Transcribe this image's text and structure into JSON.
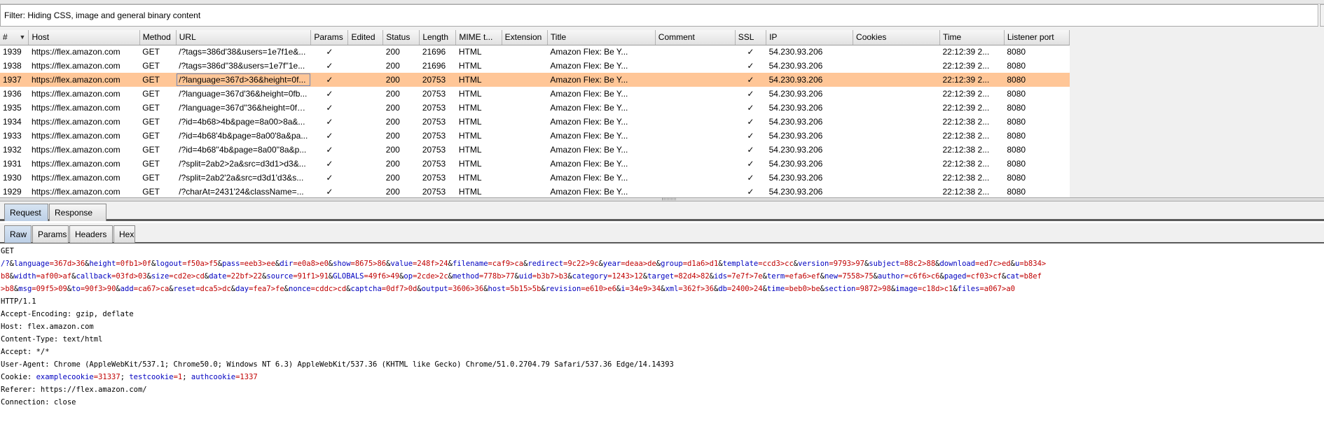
{
  "filter": {
    "text": "Filter: Hiding CSS, image and general binary content"
  },
  "table": {
    "columns": [
      "#",
      "Host",
      "Method",
      "URL",
      "Params",
      "Edited",
      "Status",
      "Length",
      "MIME t...",
      "Extension",
      "Title",
      "Comment",
      "SSL",
      "IP",
      "Cookies",
      "Time",
      "Listener port"
    ],
    "rows": [
      {
        "num": "1939",
        "host": "https://flex.amazon.com",
        "method": "GET",
        "url": "/?tags=386d'38&users=1e7f1e&...",
        "params": "✓",
        "edited": "",
        "status": "200",
        "length": "21696",
        "mime": "HTML",
        "ext": "",
        "title": "Amazon Flex: Be Y...",
        "comment": "",
        "ssl": "✓",
        "ip": "54.230.93.206",
        "cookies": "",
        "time": "22:12:39 2...",
        "port": "8080"
      },
      {
        "num": "1938",
        "host": "https://flex.amazon.com",
        "method": "GET",
        "url": "/?tags=386d''38&users=1e7f''1e...",
        "params": "✓",
        "edited": "",
        "status": "200",
        "length": "21696",
        "mime": "HTML",
        "ext": "",
        "title": "Amazon Flex: Be Y...",
        "comment": "",
        "ssl": "✓",
        "ip": "54.230.93.206",
        "cookies": "",
        "time": "22:12:39 2...",
        "port": "8080"
      },
      {
        "num": "1937",
        "host": "https://flex.amazon.com",
        "method": "GET",
        "url": "/?language=367d>36&height=0f...",
        "params": "✓",
        "edited": "",
        "status": "200",
        "length": "20753",
        "mime": "HTML",
        "ext": "",
        "title": "Amazon Flex: Be Y...",
        "comment": "",
        "ssl": "✓",
        "ip": "54.230.93.206",
        "cookies": "",
        "time": "22:12:39 2...",
        "port": "8080"
      },
      {
        "num": "1936",
        "host": "https://flex.amazon.com",
        "method": "GET",
        "url": "/?language=367d'36&height=0fb...",
        "params": "✓",
        "edited": "",
        "status": "200",
        "length": "20753",
        "mime": "HTML",
        "ext": "",
        "title": "Amazon Flex: Be Y...",
        "comment": "",
        "ssl": "✓",
        "ip": "54.230.93.206",
        "cookies": "",
        "time": "22:12:39 2...",
        "port": "8080"
      },
      {
        "num": "1935",
        "host": "https://flex.amazon.com",
        "method": "GET",
        "url": "/?language=367d''36&height=0fb...",
        "params": "✓",
        "edited": "",
        "status": "200",
        "length": "20753",
        "mime": "HTML",
        "ext": "",
        "title": "Amazon Flex: Be Y...",
        "comment": "",
        "ssl": "✓",
        "ip": "54.230.93.206",
        "cookies": "",
        "time": "22:12:39 2...",
        "port": "8080"
      },
      {
        "num": "1934",
        "host": "https://flex.amazon.com",
        "method": "GET",
        "url": "/?id=4b68>4b&page=8a00>8a&...",
        "params": "✓",
        "edited": "",
        "status": "200",
        "length": "20753",
        "mime": "HTML",
        "ext": "",
        "title": "Amazon Flex: Be Y...",
        "comment": "",
        "ssl": "✓",
        "ip": "54.230.93.206",
        "cookies": "",
        "time": "22:12:38 2...",
        "port": "8080"
      },
      {
        "num": "1933",
        "host": "https://flex.amazon.com",
        "method": "GET",
        "url": "/?id=4b68'4b&page=8a00'8a&pa...",
        "params": "✓",
        "edited": "",
        "status": "200",
        "length": "20753",
        "mime": "HTML",
        "ext": "",
        "title": "Amazon Flex: Be Y...",
        "comment": "",
        "ssl": "✓",
        "ip": "54.230.93.206",
        "cookies": "",
        "time": "22:12:38 2...",
        "port": "8080"
      },
      {
        "num": "1932",
        "host": "https://flex.amazon.com",
        "method": "GET",
        "url": "/?id=4b68''4b&page=8a00''8a&p...",
        "params": "✓",
        "edited": "",
        "status": "200",
        "length": "20753",
        "mime": "HTML",
        "ext": "",
        "title": "Amazon Flex: Be Y...",
        "comment": "",
        "ssl": "✓",
        "ip": "54.230.93.206",
        "cookies": "",
        "time": "22:12:38 2...",
        "port": "8080"
      },
      {
        "num": "1931",
        "host": "https://flex.amazon.com",
        "method": "GET",
        "url": "/?split=2ab2>2a&src=d3d1>d3&...",
        "params": "✓",
        "edited": "",
        "status": "200",
        "length": "20753",
        "mime": "HTML",
        "ext": "",
        "title": "Amazon Flex: Be Y...",
        "comment": "",
        "ssl": "✓",
        "ip": "54.230.93.206",
        "cookies": "",
        "time": "22:12:38 2...",
        "port": "8080"
      },
      {
        "num": "1930",
        "host": "https://flex.amazon.com",
        "method": "GET",
        "url": "/?split=2ab2'2a&src=d3d1'd3&s...",
        "params": "✓",
        "edited": "",
        "status": "200",
        "length": "20753",
        "mime": "HTML",
        "ext": "",
        "title": "Amazon Flex: Be Y...",
        "comment": "",
        "ssl": "✓",
        "ip": "54.230.93.206",
        "cookies": "",
        "time": "22:12:38 2...",
        "port": "8080"
      },
      {
        "num": "1929",
        "host": "https://flex.amazon.com",
        "method": "GET",
        "url": "/?charAt=2431'24&className=...",
        "params": "✓",
        "edited": "",
        "status": "200",
        "length": "20753",
        "mime": "HTML",
        "ext": "",
        "title": "Amazon Flex: Be Y...",
        "comment": "",
        "ssl": "✓",
        "ip": "54.230.93.206",
        "cookies": "",
        "time": "22:12:38 2...",
        "port": "8080"
      }
    ],
    "selected_num": "1937"
  },
  "tabs_top": [
    {
      "label": "Request",
      "active": true
    },
    {
      "label": "Response",
      "active": false
    }
  ],
  "tabs_sub": [
    {
      "label": "Raw",
      "active": true
    },
    {
      "label": "Params",
      "active": false
    },
    {
      "label": "Headers",
      "active": false
    },
    {
      "label": "Hex",
      "active": false
    }
  ],
  "request": {
    "method": "GET",
    "query_lines": [
      [
        [
          "/?",
          ""
        ],
        [
          "language",
          "=367d>36"
        ],
        [
          "height",
          "=0fb1>0f"
        ],
        [
          "logout",
          "=f50a>f5"
        ],
        [
          "pass",
          "=eeb3>ee"
        ],
        [
          "dir",
          "=e0a8>e0"
        ],
        [
          "show",
          "=8675>86"
        ],
        [
          "value",
          "=248f>24"
        ],
        [
          "filename",
          "=caf9>ca"
        ],
        [
          "redirect",
          "=9c22>9c"
        ],
        [
          "year",
          "=deaa>de"
        ],
        [
          "group",
          "=d1a6>d1"
        ],
        [
          "template",
          "=ccd3>cc"
        ],
        [
          "version",
          "=9793>97"
        ],
        [
          "subject",
          "=88c2>88"
        ],
        [
          "download",
          "=ed7c>ed"
        ],
        [
          "u",
          "=b834>"
        ]
      ],
      [
        [
          "",
          "b8"
        ],
        [
          "width",
          "=af00>af"
        ],
        [
          "callback",
          "=03fd>03"
        ],
        [
          "size",
          "=cd2e>cd"
        ],
        [
          "date",
          "=22bf>22"
        ],
        [
          "source",
          "=91f1>91"
        ],
        [
          "GLOBALS",
          "=49f6>49"
        ],
        [
          "op",
          "=2cde>2c"
        ],
        [
          "method",
          "=778b>77"
        ],
        [
          "uid",
          "=b3b7>b3"
        ],
        [
          "category",
          "=1243>12"
        ],
        [
          "target",
          "=82d4>82"
        ],
        [
          "ids",
          "=7e7f>7e"
        ],
        [
          "term",
          "=efa6>ef"
        ],
        [
          "new",
          "=7558>75"
        ],
        [
          "author",
          "=c6f6>c6"
        ],
        [
          "paged",
          "=cf03>cf"
        ],
        [
          "cat",
          "=b8ef"
        ]
      ],
      [
        [
          "",
          ">b8"
        ],
        [
          "msg",
          "=09f5>09"
        ],
        [
          "to",
          "=90f3>90"
        ],
        [
          "add",
          "=ca67>ca"
        ],
        [
          "reset",
          "=dca5>dc"
        ],
        [
          "day",
          "=fea7>fe"
        ],
        [
          "nonce",
          "=cddc>cd"
        ],
        [
          "captcha",
          "=0df7>0d"
        ],
        [
          "output",
          "=3606>36"
        ],
        [
          "host",
          "=5b15>5b"
        ],
        [
          "revision",
          "=e610>e6"
        ],
        [
          "i",
          "=34e9>34"
        ],
        [
          "xml",
          "=362f>36"
        ],
        [
          "db",
          "=2400>24"
        ],
        [
          "time",
          "=beb0>be"
        ],
        [
          "section",
          "=9872>98"
        ],
        [
          "image",
          "=c18d>c1"
        ],
        [
          "files",
          "=a067>a0"
        ]
      ]
    ],
    "http_version": "HTTP/1.1",
    "headers": [
      "Accept-Encoding: gzip, deflate",
      "Host: flex.amazon.com",
      "Content-Type: text/html",
      "Accept: */*",
      "User-Agent: Chrome (AppleWebKit/537.1; Chrome50.0; Windows NT 6.3) AppleWebKit/537.36 (KHTML like Gecko) Chrome/51.0.2704.79 Safari/537.36 Edge/14.14393"
    ],
    "cookie_label": "Cookie:",
    "cookies": [
      {
        "name": "examplecookie",
        "value": "=31337"
      },
      {
        "name": "testcookie",
        "value": "=1"
      },
      {
        "name": "authcookie",
        "value": "=1337"
      }
    ],
    "headers_after": [
      "Referer: https://flex.amazon.com/",
      "Connection: close"
    ]
  },
  "colors": {
    "selected_row": "#ffc697",
    "param_name": "#0000c0",
    "param_value": "#c00000"
  }
}
